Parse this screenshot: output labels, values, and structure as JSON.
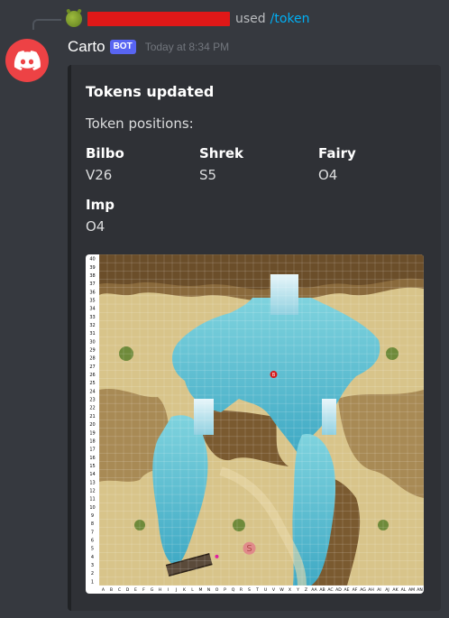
{
  "reply": {
    "used_text": "used",
    "command": "/token"
  },
  "message": {
    "username": "Carto",
    "bot_tag": "BOT",
    "timestamp": "Today at 8:34 PM"
  },
  "embed": {
    "title": "Tokens updated",
    "description": "Token positions:",
    "fields": [
      {
        "name": "Bilbo",
        "value": "V26"
      },
      {
        "name": "Shrek",
        "value": "S5"
      },
      {
        "name": "Fairy",
        "value": "O4"
      },
      {
        "name": "Imp",
        "value": "O4"
      }
    ],
    "map": {
      "columns": [
        "A",
        "B",
        "C",
        "D",
        "E",
        "F",
        "G",
        "H",
        "I",
        "J",
        "K",
        "L",
        "M",
        "N",
        "O",
        "P",
        "Q",
        "R",
        "S",
        "T",
        "U",
        "V",
        "W",
        "X",
        "Y",
        "Z",
        "AA",
        "AB",
        "AC",
        "AD",
        "AE",
        "AF",
        "AG",
        "AH",
        "AI",
        "AJ",
        "AK",
        "AL",
        "AM",
        "AN"
      ],
      "rows": [
        "1",
        "2",
        "3",
        "4",
        "5",
        "6",
        "7",
        "8",
        "9",
        "10",
        "11",
        "12",
        "13",
        "14",
        "15",
        "16",
        "17",
        "18",
        "19",
        "20",
        "21",
        "22",
        "23",
        "24",
        "25",
        "26",
        "27",
        "28",
        "29",
        "30",
        "31",
        "32",
        "33",
        "34",
        "35",
        "36",
        "37",
        "38",
        "39",
        "40"
      ],
      "tokens": [
        {
          "label": "B",
          "col": "V",
          "row": "26",
          "color": "#d41a1a"
        },
        {
          "label": "S",
          "col": "S",
          "row": "5",
          "color": "#e08a8a"
        },
        {
          "label": "",
          "col": "O",
          "row": "4",
          "color": "#e020a0"
        }
      ]
    }
  },
  "colors": {
    "background": "#36393f",
    "embed": "#2f3136",
    "discord_red": "#ed4245",
    "blurple": "#5865f2",
    "link": "#00aff4"
  }
}
